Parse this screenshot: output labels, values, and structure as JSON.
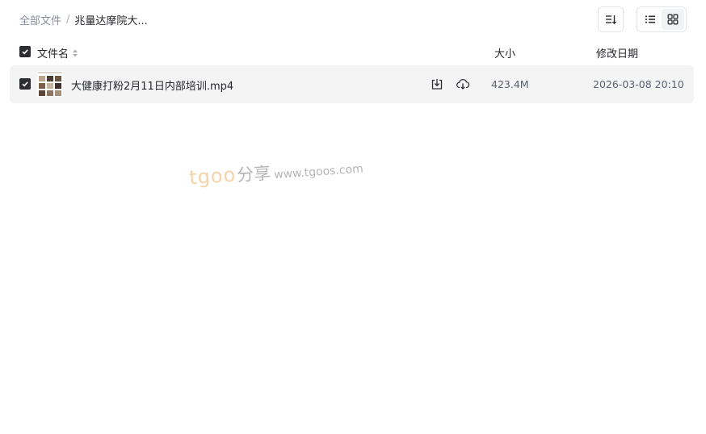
{
  "breadcrumb": {
    "root": "全部文件",
    "separator": "/",
    "current": "兆量达摩院大..."
  },
  "toolbar": {
    "sort_icon": "sort-descending-icon",
    "view_list_icon": "list-view-icon",
    "view_grid_icon": "grid-view-icon",
    "active_view": "list"
  },
  "table": {
    "columns": {
      "name": "文件名",
      "size": "大小",
      "date": "修改日期"
    },
    "header_checked": true,
    "rows": [
      {
        "checked": true,
        "name": "大健康打粉2月11日内部培训.mp4",
        "size": "423.4M",
        "date": "2026-03-08 20:10",
        "actions": [
          "download-icon",
          "cloud-save-icon"
        ]
      }
    ]
  },
  "watermark": {
    "brand": "tgoo",
    "cn": "分享",
    "url": "www.tgoos.com"
  },
  "colors": {
    "row_bg": "#f4f4f5",
    "checkbox": "#2b2d33",
    "muted_text": "#878c9c",
    "watermark_brand": "#f3c992"
  }
}
